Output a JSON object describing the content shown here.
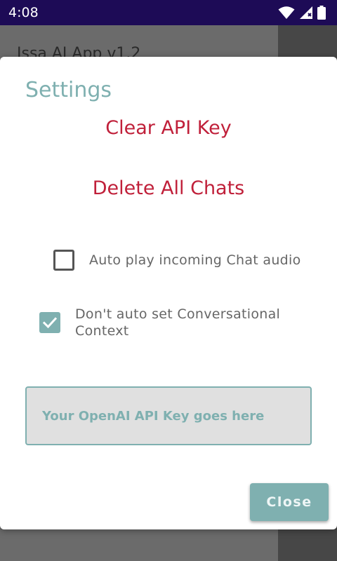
{
  "status_bar": {
    "time": "4:08",
    "icons": [
      "wifi-icon",
      "signal-icon",
      "battery-icon"
    ]
  },
  "background_app": {
    "title": "Issa AI App v1.2"
  },
  "dialog": {
    "title": "Settings",
    "clear_api_key_label": "Clear API Key",
    "delete_chats_label": "Delete All Chats",
    "options": [
      {
        "label": "Auto play incoming Chat audio",
        "checked": false
      },
      {
        "label": "Don't auto set Conversational Context",
        "checked": true
      }
    ],
    "api_key_input": {
      "value": "",
      "placeholder": "Your OpenAI API Key goes here"
    },
    "close_label": "Close"
  },
  "colors": {
    "accent_teal": "#7fb0b0",
    "action_red": "#c0203a",
    "status_bar": "#1d0b56"
  }
}
